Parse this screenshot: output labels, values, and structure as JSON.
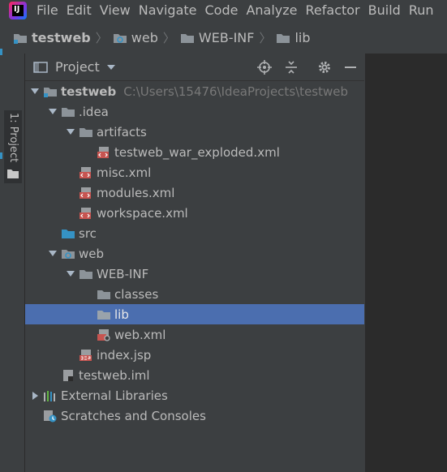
{
  "menubar": {
    "items": [
      "File",
      "Edit",
      "View",
      "Navigate",
      "Code",
      "Analyze",
      "Refactor",
      "Build",
      "Run"
    ]
  },
  "breadcrumb": [
    "testweb",
    "web",
    "WEB-INF",
    "lib"
  ],
  "sidestrip": {
    "tab_label": "1: Project"
  },
  "panel": {
    "title": "Project"
  },
  "tree": {
    "root": {
      "label": "testweb",
      "path": "C:\\Users\\15476\\IdeaProjects\\testweb"
    },
    "idea": ".idea",
    "artifacts": "artifacts",
    "war_exploded": "testweb_war_exploded.xml",
    "misc": "misc.xml",
    "modules": "modules.xml",
    "workspace": "workspace.xml",
    "src": "src",
    "web": "web",
    "webinf": "WEB-INF",
    "classes": "classes",
    "lib": "lib",
    "webxml": "web.xml",
    "indexjsp": "index.jsp",
    "iml": "testweb.iml",
    "ext_libs": "External Libraries",
    "scratches": "Scratches and Consoles"
  },
  "colors": {
    "background": "#3c3f41",
    "editor_background": "#2b2b2b",
    "selection": "#4b6eaf",
    "folder": "#8c9399",
    "xml_icon": "#c75450",
    "text": "#bbbbbb"
  }
}
